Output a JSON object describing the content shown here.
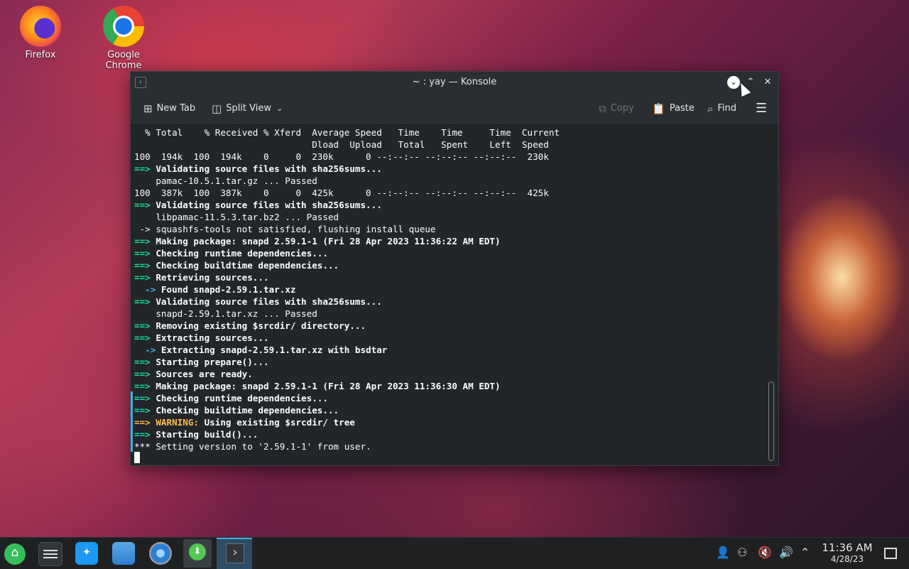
{
  "desktop": {
    "icons": [
      {
        "label": "Firefox"
      },
      {
        "label": "Google Chrome"
      }
    ]
  },
  "window": {
    "title": "~ : yay — Konsole",
    "toolbar": {
      "new_tab": "New Tab",
      "split_view": "Split View",
      "copy": "Copy",
      "paste": "Paste",
      "find": "Find"
    }
  },
  "terminal": {
    "lines": [
      [
        {
          "t": "  % Total    % Received % Xferd  Average Speed   Time    Time     Time  Current"
        }
      ],
      [
        {
          "t": "                                 Dload  Upload   Total   Spent    Left  Speed"
        }
      ],
      [
        {
          "t": "100  194k  100  194k    0     0  230k      0 --:--:-- --:--:-- --:--:--  230k"
        }
      ],
      [
        {
          "t": "==>",
          "c": "arrow"
        },
        {
          "t": " Validating source files with sha256sums...",
          "c": "bold"
        }
      ],
      [
        {
          "t": "    pamac-10.5.1.tar.gz ... Passed"
        }
      ],
      [
        {
          "t": "100  387k  100  387k    0     0  425k      0 --:--:-- --:--:-- --:--:--  425k"
        }
      ],
      [
        {
          "t": "==>",
          "c": "arrow"
        },
        {
          "t": " Validating source files with sha256sums...",
          "c": "bold"
        }
      ],
      [
        {
          "t": "    libpamac-11.5.3.tar.bz2 ... Passed"
        }
      ],
      [
        {
          "t": " -> squashfs-tools not satisfied, flushing install queue"
        }
      ],
      [
        {
          "t": "==>",
          "c": "arrow"
        },
        {
          "t": " Making package: snapd 2.59.1-1 (Fri 28 Apr 2023 11:36:22 AM EDT)",
          "c": "bold"
        }
      ],
      [
        {
          "t": "==>",
          "c": "arrow"
        },
        {
          "t": " Checking runtime dependencies...",
          "c": "bold"
        }
      ],
      [
        {
          "t": "==>",
          "c": "arrow"
        },
        {
          "t": " Checking buildtime dependencies...",
          "c": "bold"
        }
      ],
      [
        {
          "t": "==>",
          "c": "arrow"
        },
        {
          "t": " Retrieving sources...",
          "c": "bold"
        }
      ],
      [
        {
          "t": "  ->",
          "c": "sarrow"
        },
        {
          "t": " Found snapd-2.59.1.tar.xz",
          "c": "bold"
        }
      ],
      [
        {
          "t": "==>",
          "c": "arrow"
        },
        {
          "t": " Validating source files with sha256sums...",
          "c": "bold"
        }
      ],
      [
        {
          "t": "    snapd-2.59.1.tar.xz ... Passed"
        }
      ],
      [
        {
          "t": "==>",
          "c": "arrow"
        },
        {
          "t": " Removing existing $srcdir/ directory...",
          "c": "bold"
        }
      ],
      [
        {
          "t": "==>",
          "c": "arrow"
        },
        {
          "t": " Extracting sources...",
          "c": "bold"
        }
      ],
      [
        {
          "t": "  ->",
          "c": "sarrow"
        },
        {
          "t": " Extracting snapd-2.59.1.tar.xz with bsdtar",
          "c": "bold"
        }
      ],
      [
        {
          "t": "==>",
          "c": "arrow"
        },
        {
          "t": " Starting prepare()...",
          "c": "bold"
        }
      ],
      [
        {
          "t": "==>",
          "c": "arrow"
        },
        {
          "t": " Sources are ready.",
          "c": "bold"
        }
      ],
      [
        {
          "t": "==>",
          "c": "arrow"
        },
        {
          "t": " Making package: snapd 2.59.1-1 (Fri 28 Apr 2023 11:36:30 AM EDT)",
          "c": "bold"
        }
      ],
      [
        {
          "t": "==>",
          "c": "arrow"
        },
        {
          "t": " Checking runtime dependencies...",
          "c": "bold"
        }
      ],
      [
        {
          "t": "==>",
          "c": "arrow"
        },
        {
          "t": " Checking buildtime dependencies...",
          "c": "bold"
        }
      ],
      [
        {
          "t": "==>",
          "c": "yarrow"
        },
        {
          "t": " WARNING:",
          "c": "warn"
        },
        {
          "t": " Using existing $srcdir/ tree",
          "c": "bold"
        }
      ],
      [
        {
          "t": "==>",
          "c": "arrow"
        },
        {
          "t": " Starting build()...",
          "c": "bold"
        }
      ],
      [
        {
          "t": "*** Setting version to '2.59.1-1' from user."
        }
      ]
    ]
  },
  "taskbar": {
    "clock_time": "11:36 AM",
    "clock_date": "4/28/23"
  },
  "colors": {
    "accent": "#3daee9",
    "arrow_green": "#1cdc9a",
    "warning": "#fdbc4b"
  }
}
